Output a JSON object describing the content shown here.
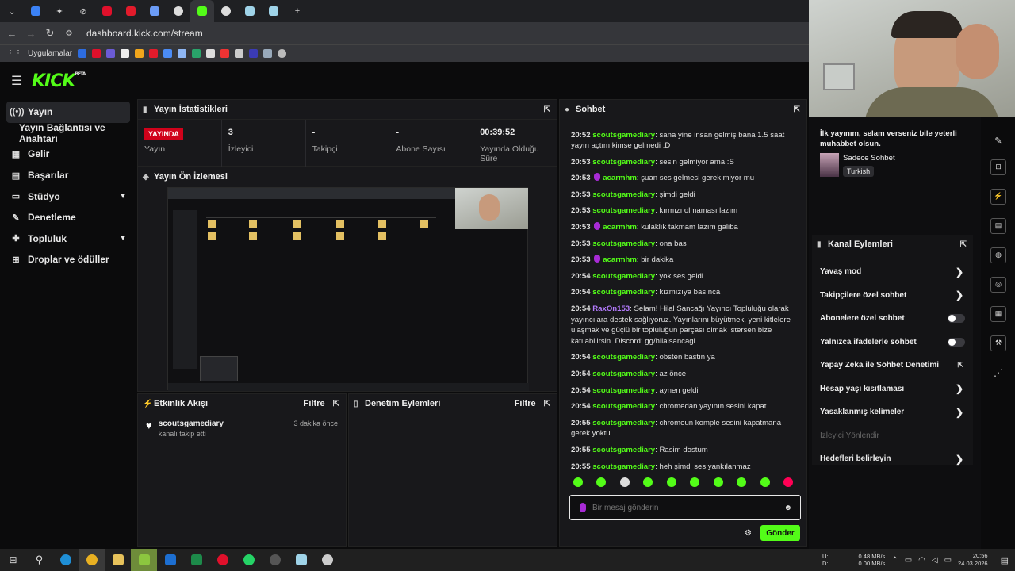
{
  "browser": {
    "url": "dashboard.kick.com/stream",
    "bookmarks_label": "Uygulamalar",
    "new_tab": "+"
  },
  "kick": {
    "logo": "KICK",
    "logo_badge": "BETA"
  },
  "sidebar": {
    "items": [
      {
        "label": "Yayın",
        "icon": "broadcast-icon"
      },
      {
        "label": "Yayın Bağlantısı ve Anahtarı",
        "icon": "key-icon"
      },
      {
        "label": "Gelir",
        "icon": "revenue-icon"
      },
      {
        "label": "Başarılar",
        "icon": "achievements-icon"
      },
      {
        "label": "Stüdyo",
        "icon": "studio-icon"
      },
      {
        "label": "Denetleme",
        "icon": "moderation-icon"
      },
      {
        "label": "Topluluk",
        "icon": "community-icon"
      },
      {
        "label": "Droplar ve ödüller",
        "icon": "drops-icon"
      }
    ]
  },
  "stats_panel": {
    "title": "Yayın İstatistikleri",
    "live_badge": "YAYINDA",
    "stats": [
      {
        "value": "",
        "label": "Yayın"
      },
      {
        "value": "3",
        "label": "İzleyici"
      },
      {
        "value": "-",
        "label": "Takipçi"
      },
      {
        "value": "-",
        "label": "Abone Sayısı"
      },
      {
        "value": "00:39:52",
        "label": "Yayında Olduğu Süre"
      }
    ]
  },
  "preview_panel": {
    "title": "Yayın Ön İzlemesi"
  },
  "activity_panel": {
    "title": "Etkinlik Akışı",
    "filter": "Filtre",
    "events": [
      {
        "user": "scoutsgamediary",
        "action": "kanalı takip etti",
        "time": "3 dakika önce"
      }
    ]
  },
  "moderation_panel": {
    "title": "Denetim Eylemleri",
    "filter": "Filtre"
  },
  "chat": {
    "title": "Sohbet",
    "messages": [
      {
        "time": "20:52",
        "user": "scoutsgamediary",
        "color": "#53fc18",
        "mic": false,
        "text": "sana yine insan gelmiş bana 1.5 saat yayın açtım kimse gelmedi :D"
      },
      {
        "time": "20:53",
        "user": "scoutsgamediary",
        "color": "#53fc18",
        "mic": false,
        "text": "sesin gelmiyor ama :S"
      },
      {
        "time": "20:53",
        "user": "acarmhm",
        "color": "#53fc18",
        "mic": true,
        "text": "şuan ses gelmesi gerek miyor mu"
      },
      {
        "time": "20:53",
        "user": "scoutsgamediary",
        "color": "#53fc18",
        "mic": false,
        "text": "şimdi geldi"
      },
      {
        "time": "20:53",
        "user": "scoutsgamediary",
        "color": "#53fc18",
        "mic": false,
        "text": "kırmızı olmaması lazım"
      },
      {
        "time": "20:53",
        "user": "acarmhm",
        "color": "#53fc18",
        "mic": true,
        "text": "kulaklık takmam lazım galiba"
      },
      {
        "time": "20:53",
        "user": "scoutsgamediary",
        "color": "#53fc18",
        "mic": false,
        "text": "ona bas"
      },
      {
        "time": "20:53",
        "user": "acarmhm",
        "color": "#53fc18",
        "mic": true,
        "text": "bir dakika"
      },
      {
        "time": "20:54",
        "user": "scoutsgamediary",
        "color": "#53fc18",
        "mic": false,
        "text": "yok ses geldi"
      },
      {
        "time": "20:54",
        "user": "scoutsgamediary",
        "color": "#53fc18",
        "mic": false,
        "text": "kızmızıya basınca"
      },
      {
        "time": "20:54",
        "user": "RaxOn153",
        "color": "#b57cff",
        "mic": false,
        "text": "Selam! Hilal Sancağı Yayıncı Topluluğu olarak yayıncılara destek sağlıyoruz. Yayınlarını büyütmek, yeni kitlelere ulaşmak ve güçlü bir topluluğun parçası olmak istersen bize katılabilirsin. Discord: gg/hilalsancagi"
      },
      {
        "time": "20:54",
        "user": "scoutsgamediary",
        "color": "#53fc18",
        "mic": false,
        "text": "obsten bastın ya"
      },
      {
        "time": "20:54",
        "user": "scoutsgamediary",
        "color": "#53fc18",
        "mic": false,
        "text": "az önce"
      },
      {
        "time": "20:54",
        "user": "scoutsgamediary",
        "color": "#53fc18",
        "mic": false,
        "text": "aynen geldi"
      },
      {
        "time": "20:54",
        "user": "scoutsgamediary",
        "color": "#53fc18",
        "mic": false,
        "text": "chromedan yayının sesini kapat"
      },
      {
        "time": "20:55",
        "user": "scoutsgamediary",
        "color": "#53fc18",
        "mic": false,
        "text": "chromeun komple sesini kapatmana gerek yoktu"
      },
      {
        "time": "20:55",
        "user": "scoutsgamediary",
        "color": "#53fc18",
        "mic": false,
        "text": "Rasim dostum"
      },
      {
        "time": "20:55",
        "user": "scoutsgamediary",
        "color": "#53fc18",
        "mic": false,
        "text": "heh şimdi ses yankılanmaz"
      }
    ],
    "input_placeholder": "Bir mesaj gönderin",
    "send_label": "Gönder"
  },
  "stream_info": {
    "title": "İlk yayınım, selam verseniz bile yeterli muhabbet olsun.",
    "category": "Sadece Sohbet",
    "tag": "Turkish"
  },
  "channel_actions": {
    "title": "Kanal Eylemleri",
    "items": [
      {
        "label": "Yavaş mod",
        "control": "arrow"
      },
      {
        "label": "Takipçilere özel sohbet",
        "control": "arrow"
      },
      {
        "label": "Abonelere özel sohbet",
        "control": "toggle"
      },
      {
        "label": "Yalnızca ifadelerle sohbet",
        "control": "toggle"
      },
      {
        "label": "Yapay Zeka ile Sohbet Denetimi",
        "control": "external"
      },
      {
        "label": "Hesap yaşı kısıtlaması",
        "control": "arrow"
      },
      {
        "label": "Yasaklanmış kelimeler",
        "control": "arrow"
      },
      {
        "label": "İzleyici Yönlendir",
        "control": "none",
        "disabled": true
      },
      {
        "label": "Hedefleri belirleyin",
        "control": "arrow"
      }
    ]
  },
  "taskbar": {
    "net_up": "0.48 MB/s",
    "net_down": "0.00 MB/s",
    "net_up_label": "U:",
    "net_down_label": "D:",
    "time": "20:56",
    "date": "24.03.2026"
  }
}
